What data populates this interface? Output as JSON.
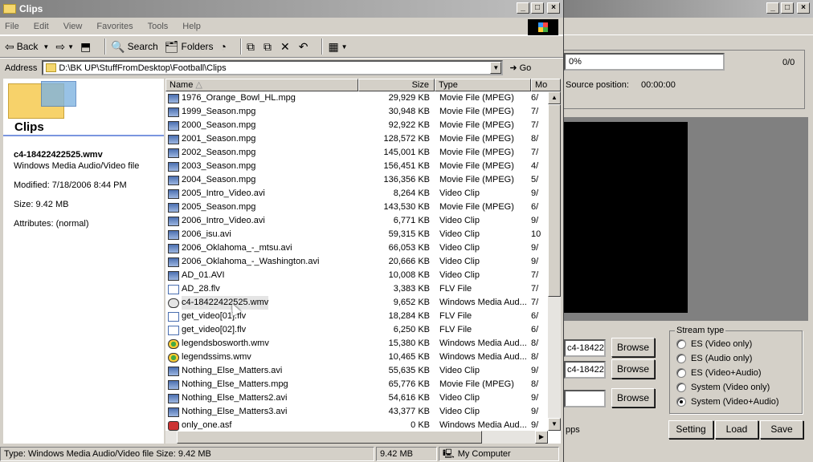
{
  "explorer": {
    "title": "Clips",
    "menu": [
      "File",
      "Edit",
      "View",
      "Favorites",
      "Tools",
      "Help"
    ],
    "toolbar": {
      "back": "Back",
      "search": "Search",
      "folders": "Folders"
    },
    "address_label": "Address",
    "address": "D:\\BK UP\\StuffFromDesktop\\Football\\Clips",
    "go": "Go",
    "left": {
      "title": "Clips",
      "file": "c4-18422422525.wmv",
      "filetype": "Windows Media Audio/Video file",
      "modified": "Modified: 7/18/2006 8:44 PM",
      "size": "Size: 9.42 MB",
      "attributes": "Attributes: (normal)"
    },
    "columns": {
      "name": "Name",
      "size": "Size",
      "type": "Type",
      "modified": "Mo"
    },
    "files": [
      {
        "name": "1976_Orange_Bowl_HL.mpg",
        "size": "29,929 KB",
        "type": "Movie File (MPEG)",
        "mod": "6/",
        "icon": "movie"
      },
      {
        "name": "1999_Season.mpg",
        "size": "30,948 KB",
        "type": "Movie File (MPEG)",
        "mod": "7/",
        "icon": "movie"
      },
      {
        "name": "2000_Season.mpg",
        "size": "92,922 KB",
        "type": "Movie File (MPEG)",
        "mod": "7/",
        "icon": "movie"
      },
      {
        "name": "2001_Season.mpg",
        "size": "128,572 KB",
        "type": "Movie File (MPEG)",
        "mod": "8/",
        "icon": "movie"
      },
      {
        "name": "2002_Season.mpg",
        "size": "145,001 KB",
        "type": "Movie File (MPEG)",
        "mod": "7/",
        "icon": "movie"
      },
      {
        "name": "2003_Season.mpg",
        "size": "156,451 KB",
        "type": "Movie File (MPEG)",
        "mod": "4/",
        "icon": "movie"
      },
      {
        "name": "2004_Season.mpg",
        "size": "136,356 KB",
        "type": "Movie File (MPEG)",
        "mod": "5/",
        "icon": "movie"
      },
      {
        "name": "2005_Intro_Video.avi",
        "size": "8,264 KB",
        "type": "Video Clip",
        "mod": "9/",
        "icon": "movie"
      },
      {
        "name": "2005_Season.mpg",
        "size": "143,530 KB",
        "type": "Movie File (MPEG)",
        "mod": "6/",
        "icon": "movie"
      },
      {
        "name": "2006_Intro_Video.avi",
        "size": "6,771 KB",
        "type": "Video Clip",
        "mod": "9/",
        "icon": "movie"
      },
      {
        "name": "2006_isu.avi",
        "size": "59,315 KB",
        "type": "Video Clip",
        "mod": "10",
        "icon": "movie"
      },
      {
        "name": "2006_Oklahoma_-_mtsu.avi",
        "size": "66,053 KB",
        "type": "Video Clip",
        "mod": "9/",
        "icon": "movie"
      },
      {
        "name": "2006_Oklahoma_-_Washington.avi",
        "size": "20,666 KB",
        "type": "Video Clip",
        "mod": "9/",
        "icon": "movie"
      },
      {
        "name": "AD_01.AVI",
        "size": "10,008 KB",
        "type": "Video Clip",
        "mod": "7/",
        "icon": "movie"
      },
      {
        "name": "AD_28.flv",
        "size": "3,383 KB",
        "type": "FLV File",
        "mod": "7/",
        "icon": "flv"
      },
      {
        "name": "c4-18422422525.wmv",
        "size": "9,652 KB",
        "type": "Windows Media Aud...",
        "mod": "7/",
        "icon": "wmv",
        "selected": true
      },
      {
        "name": "get_video[01].flv",
        "size": "18,284 KB",
        "type": "FLV File",
        "mod": "6/",
        "icon": "flv"
      },
      {
        "name": "get_video[02].flv",
        "size": "6,250 KB",
        "type": "FLV File",
        "mod": "6/",
        "icon": "flv"
      },
      {
        "name": "legendsbosworth.wmv",
        "size": "15,380 KB",
        "type": "Windows Media Aud...",
        "mod": "8/",
        "icon": "wmv"
      },
      {
        "name": "legendssims.wmv",
        "size": "10,465 KB",
        "type": "Windows Media Aud...",
        "mod": "8/",
        "icon": "wmv"
      },
      {
        "name": "Nothing_Else_Matters.avi",
        "size": "55,635 KB",
        "type": "Video Clip",
        "mod": "9/",
        "icon": "movie"
      },
      {
        "name": "Nothing_Else_Matters.mpg",
        "size": "65,776 KB",
        "type": "Movie File (MPEG)",
        "mod": "8/",
        "icon": "movie"
      },
      {
        "name": "Nothing_Else_Matters2.avi",
        "size": "54,616 KB",
        "type": "Video Clip",
        "mod": "9/",
        "icon": "movie"
      },
      {
        "name": "Nothing_Else_Matters3.avi",
        "size": "43,377 KB",
        "type": "Video Clip",
        "mod": "9/",
        "icon": "movie"
      },
      {
        "name": "only_one.asf",
        "size": "0 KB",
        "type": "Windows Media Aud...",
        "mod": "9/",
        "icon": "asf"
      }
    ],
    "status": {
      "type": "Type: Windows Media Audio/Video file Size: 9.42 MB",
      "size": "9.42 MB",
      "location": "My Computer"
    }
  },
  "encoder": {
    "progress": "0%",
    "count": "0/0",
    "source_label": "Source position:",
    "source_value": "00:00:00",
    "field1": "c4-18422",
    "field2": "c4-18422",
    "browse": "Browse",
    "stream_label": "Stream type",
    "stream_options": [
      "ES (Video only)",
      "ES (Audio only)",
      "ES (Video+Audio)",
      "System (Video only)",
      "System (Video+Audio)"
    ],
    "stream_selected": 4,
    "setting": "Setting",
    "load": "Load",
    "save": "Save",
    "low_text": "pps"
  }
}
